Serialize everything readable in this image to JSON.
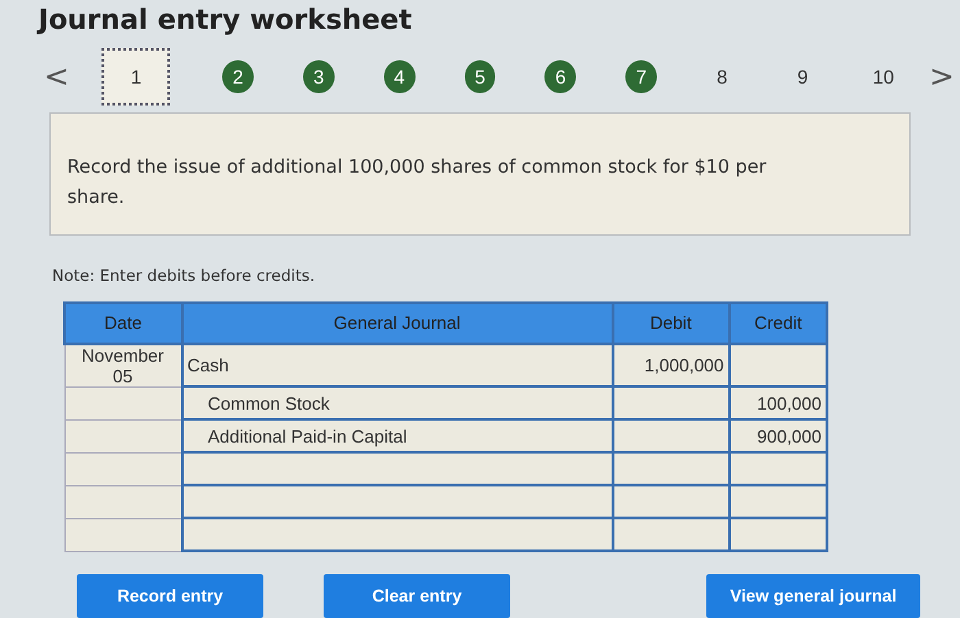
{
  "title": "Journal entry worksheet",
  "pager": {
    "prev": "<",
    "next": ">"
  },
  "steps": [
    {
      "label": "1",
      "selected": true,
      "done": false
    },
    {
      "label": "2",
      "selected": false,
      "done": true
    },
    {
      "label": "3",
      "selected": false,
      "done": true
    },
    {
      "label": "4",
      "selected": false,
      "done": true
    },
    {
      "label": "5",
      "selected": false,
      "done": true
    },
    {
      "label": "6",
      "selected": false,
      "done": true
    },
    {
      "label": "7",
      "selected": false,
      "done": true
    },
    {
      "label": "8",
      "selected": false,
      "done": false
    },
    {
      "label": "9",
      "selected": false,
      "done": false
    },
    {
      "label": "10",
      "selected": false,
      "done": false
    }
  ],
  "prompt": "Record the issue of additional 100,000 shares of common stock for $10 per share.",
  "note": "Note: Enter debits before credits.",
  "table": {
    "columns": [
      "Date",
      "General Journal",
      "Debit",
      "Credit"
    ],
    "rows": [
      {
        "date": "November 05",
        "account": "Cash",
        "indented": false,
        "debit": "1,000,000",
        "credit": ""
      },
      {
        "date": "",
        "account": "Common Stock",
        "indented": true,
        "debit": "",
        "credit": "100,000"
      },
      {
        "date": "",
        "account": "Additional Paid-in Capital",
        "indented": true,
        "debit": "",
        "credit": "900,000"
      },
      {
        "date": "",
        "account": "",
        "debit": "",
        "credit": ""
      },
      {
        "date": "",
        "account": "",
        "debit": "",
        "credit": ""
      },
      {
        "date": "",
        "account": "",
        "debit": "",
        "credit": ""
      }
    ]
  },
  "buttons": [
    "Record entry",
    "Clear entry",
    "View general journal"
  ]
}
